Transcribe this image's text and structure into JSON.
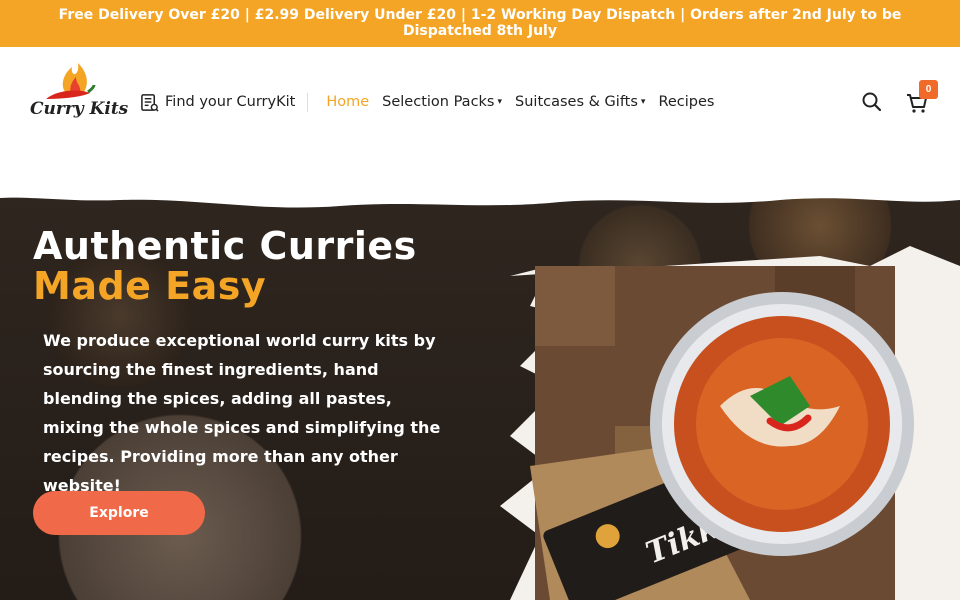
{
  "announcement": "Free Delivery Over £20 | £2.99 Delivery Under £20 | 1-2 Working Day Dispatch | Orders after 2nd July to be Dispatched 8th July",
  "logo": {
    "text": "Curry Kits"
  },
  "nav": {
    "find": "Find your CurryKit",
    "links": [
      {
        "label": "Home",
        "active": true
      },
      {
        "label": "Selection Packs",
        "dropdown": true
      },
      {
        "label": "Suitcases & Gifts",
        "dropdown": true
      },
      {
        "label": "Recipes"
      }
    ]
  },
  "cart": {
    "count": "0"
  },
  "hero": {
    "title_line1": "Authentic Curries",
    "title_line2": "Made Easy",
    "description": "We produce exceptional world curry kits by sourcing the finest ingredients, hand blending the spices, adding all pastes, mixing the whole spices and simplifying the recipes. Providing more than any other website!",
    "cta": "Explore",
    "package_text": "Tikka Masala"
  },
  "colors": {
    "accent": "#f4a526",
    "button": "#f06a4a",
    "badge": "#f06a2a"
  }
}
